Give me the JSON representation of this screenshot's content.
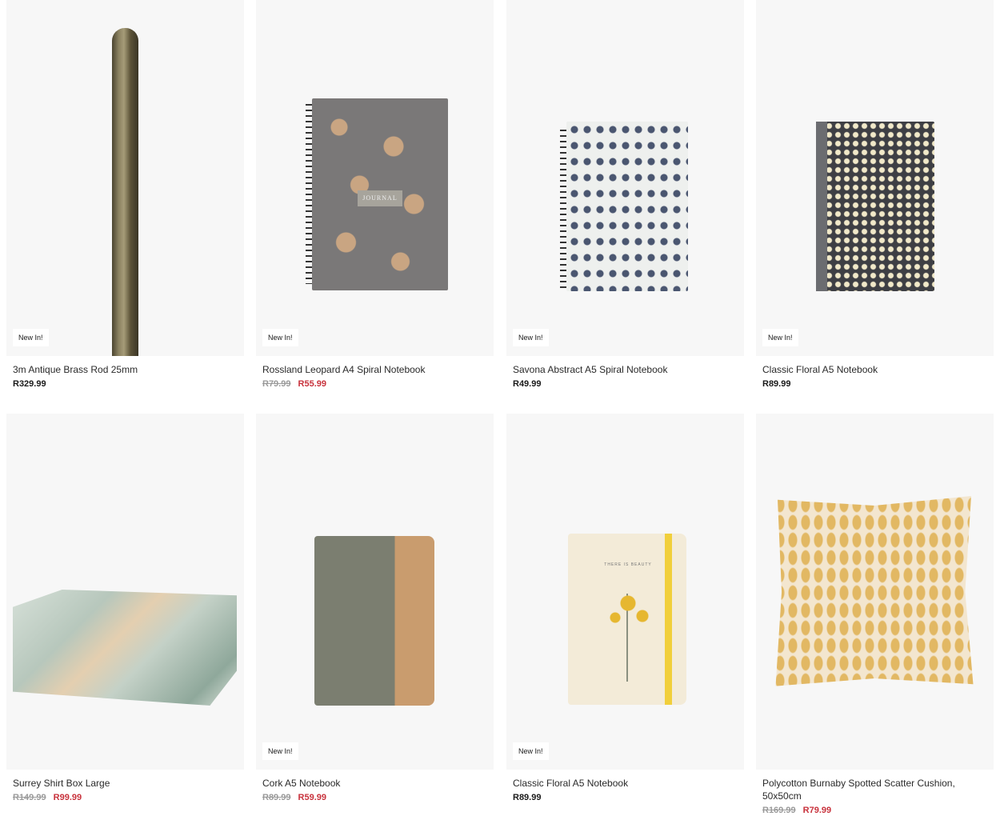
{
  "badge_text": "New In!",
  "products": [
    {
      "name": "3m Antique Brass Rod 25mm",
      "new": true,
      "old_price": "",
      "price": "R329.99",
      "image": "brass-rod"
    },
    {
      "name": "Rossland Leopard A4 Spiral Notebook",
      "new": true,
      "old_price": "R79.99",
      "price": "R55.99",
      "image": "leopard-notebook",
      "cover_label": "JOURNAL"
    },
    {
      "name": "Savona Abstract A5 Spiral Notebook",
      "new": true,
      "old_price": "",
      "price": "R49.99",
      "image": "abstract-notebook"
    },
    {
      "name": "Classic Floral A5 Notebook",
      "new": true,
      "old_price": "",
      "price": "R89.99",
      "image": "floral-notebook"
    },
    {
      "name": "Surrey Shirt Box Large",
      "new": false,
      "old_price": "R149.99",
      "price": "R99.99",
      "image": "marble-box"
    },
    {
      "name": "Cork A5 Notebook",
      "new": true,
      "old_price": "R89.99",
      "price": "R59.99",
      "image": "cork-notebook"
    },
    {
      "name": "Classic Floral A5 Notebook",
      "new": true,
      "old_price": "",
      "price": "R89.99",
      "image": "cream-floral-notebook",
      "cover_label": "THERE IS BEAUTY"
    },
    {
      "name": "Polycotton Burnaby Spotted Scatter Cushion, 50x50cm",
      "new": false,
      "old_price": "R169.99",
      "price": "R79.99",
      "image": "spotted-cushion"
    }
  ],
  "colors": {
    "sale": "#c8323c",
    "old": "#9a9a9a",
    "image_bg": "#f7f7f7"
  }
}
